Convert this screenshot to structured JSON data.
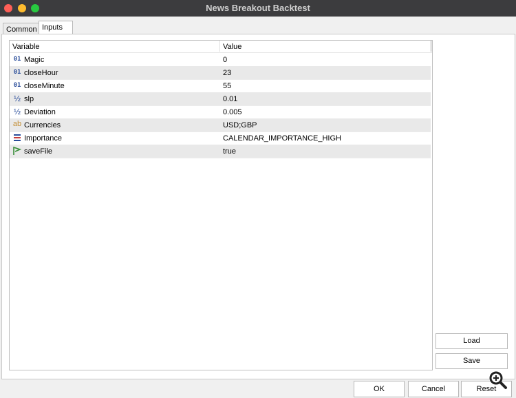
{
  "window": {
    "title": "News Breakout Backtest"
  },
  "tabs": [
    {
      "label": "Common",
      "active": false
    },
    {
      "label": "Inputs",
      "active": true
    }
  ],
  "grid": {
    "columns": [
      "Variable",
      "Value"
    ],
    "rows": [
      {
        "icon": "integer-icon",
        "icon_text": "01",
        "variable": "Magic",
        "value": "0"
      },
      {
        "icon": "integer-icon",
        "icon_text": "01",
        "variable": "closeHour",
        "value": "23"
      },
      {
        "icon": "integer-icon",
        "icon_text": "01",
        "variable": "closeMinute",
        "value": "55"
      },
      {
        "icon": "double-icon",
        "icon_text": "½",
        "variable": "slp",
        "value": "0.01"
      },
      {
        "icon": "double-icon",
        "icon_text": "½",
        "variable": "Deviation",
        "value": "0.005"
      },
      {
        "icon": "string-icon",
        "icon_text": "ab",
        "variable": "Currencies",
        "value": "USD;GBP"
      },
      {
        "icon": "enum-icon",
        "icon_text": "",
        "variable": "Importance",
        "value": "CALENDAR_IMPORTANCE_HIGH"
      },
      {
        "icon": "bool-icon",
        "icon_text": "",
        "variable": "saveFile",
        "value": "true"
      }
    ]
  },
  "side_buttons": {
    "load": "Load",
    "save": "Save"
  },
  "footer_buttons": {
    "ok": "OK",
    "cancel": "Cancel",
    "reset": "Reset"
  },
  "colors": {
    "titlebar": "#3c3c3e",
    "row_alt": "#e9e9e9",
    "integer_icon": "#2a4d9a",
    "string_icon": "#c49039",
    "bool_icon": "#3a8f3a"
  },
  "icons": {
    "zoom": "zoom-in-icon"
  }
}
